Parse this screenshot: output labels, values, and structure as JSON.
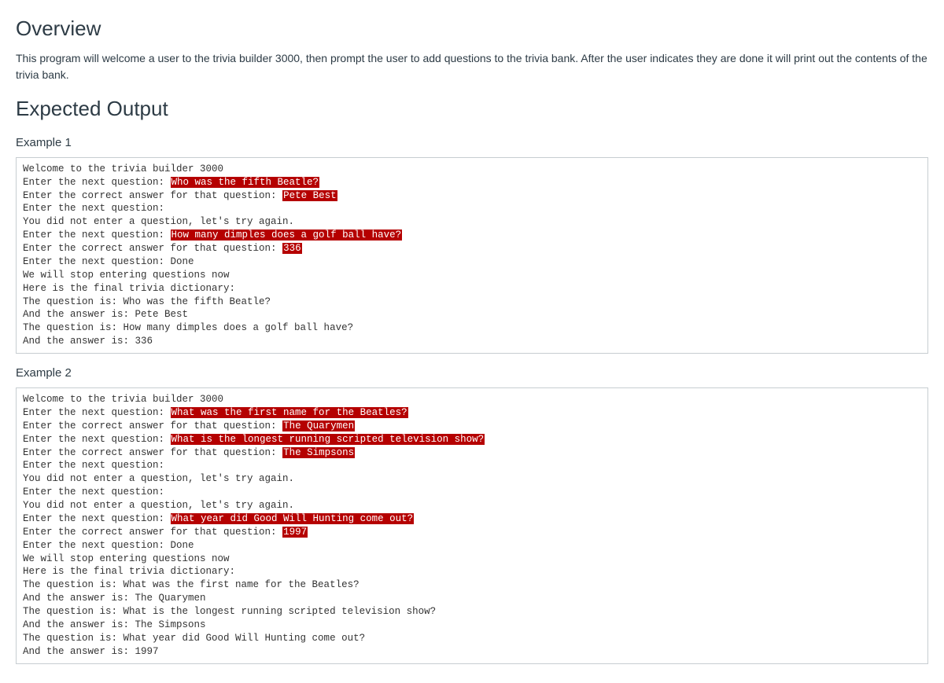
{
  "overview": {
    "heading": "Overview",
    "text": "This program will welcome a user to the trivia builder 3000, then prompt the user to add questions to the trivia bank.  After the user indicates they are done it will print out the contents of the trivia bank."
  },
  "expected": {
    "heading": "Expected Output",
    "examples": [
      {
        "label": "Example 1",
        "lines": [
          [
            {
              "t": "Welcome to the trivia builder 3000"
            }
          ],
          [
            {
              "t": "Enter the next question: "
            },
            {
              "t": "Who was the fifth Beatle?",
              "hl": true
            }
          ],
          [
            {
              "t": "Enter the correct answer for that question: "
            },
            {
              "t": "Pete Best",
              "hl": true
            }
          ],
          [
            {
              "t": "Enter the next question: "
            }
          ],
          [
            {
              "t": "You did not enter a question, let's try again."
            }
          ],
          [
            {
              "t": "Enter the next question: "
            },
            {
              "t": "How many dimples does a golf ball have?",
              "hl": true
            }
          ],
          [
            {
              "t": "Enter the correct answer for that question: "
            },
            {
              "t": "336",
              "hl": true
            }
          ],
          [
            {
              "t": "Enter the next question: Done"
            }
          ],
          [
            {
              "t": "We will stop entering questions now"
            }
          ],
          [
            {
              "t": "Here is the final trivia dictionary:"
            }
          ],
          [
            {
              "t": "The question is: Who was the fifth Beatle?"
            }
          ],
          [
            {
              "t": "And the answer is: Pete Best"
            }
          ],
          [
            {
              "t": "The question is: How many dimples does a golf ball have?"
            }
          ],
          [
            {
              "t": "And the answer is: 336"
            }
          ]
        ]
      },
      {
        "label": "Example 2",
        "lines": [
          [
            {
              "t": "Welcome to the trivia builder 3000"
            }
          ],
          [
            {
              "t": "Enter the next question: "
            },
            {
              "t": "What was the first name for the Beatles?",
              "hl": true
            }
          ],
          [
            {
              "t": "Enter the correct answer for that question: "
            },
            {
              "t": "The Quarymen",
              "hl": true
            }
          ],
          [
            {
              "t": "Enter the next question: "
            },
            {
              "t": "What is the longest running scripted television show?",
              "hl": true
            }
          ],
          [
            {
              "t": "Enter the correct answer for that question: "
            },
            {
              "t": "The Simpsons",
              "hl": true
            }
          ],
          [
            {
              "t": "Enter the next question: "
            }
          ],
          [
            {
              "t": "You did not enter a question, let's try again."
            }
          ],
          [
            {
              "t": "Enter the next question: "
            }
          ],
          [
            {
              "t": "You did not enter a question, let's try again."
            }
          ],
          [
            {
              "t": "Enter the next question: "
            },
            {
              "t": "What year did Good Will Hunting come out?",
              "hl": true
            }
          ],
          [
            {
              "t": "Enter the correct answer for that question: "
            },
            {
              "t": "1997",
              "hl": true
            }
          ],
          [
            {
              "t": "Enter the next question: Done"
            }
          ],
          [
            {
              "t": "We will stop entering questions now"
            }
          ],
          [
            {
              "t": "Here is the final trivia dictionary:"
            }
          ],
          [
            {
              "t": "The question is: What was the first name for the Beatles?"
            }
          ],
          [
            {
              "t": "And the answer is: The Quarymen"
            }
          ],
          [
            {
              "t": "The question is: What is the longest running scripted television show?"
            }
          ],
          [
            {
              "t": "And the answer is: The Simpsons"
            }
          ],
          [
            {
              "t": "The question is: What year did Good Will Hunting come out?"
            }
          ],
          [
            {
              "t": "And the answer is: 1997"
            }
          ]
        ]
      }
    ]
  }
}
